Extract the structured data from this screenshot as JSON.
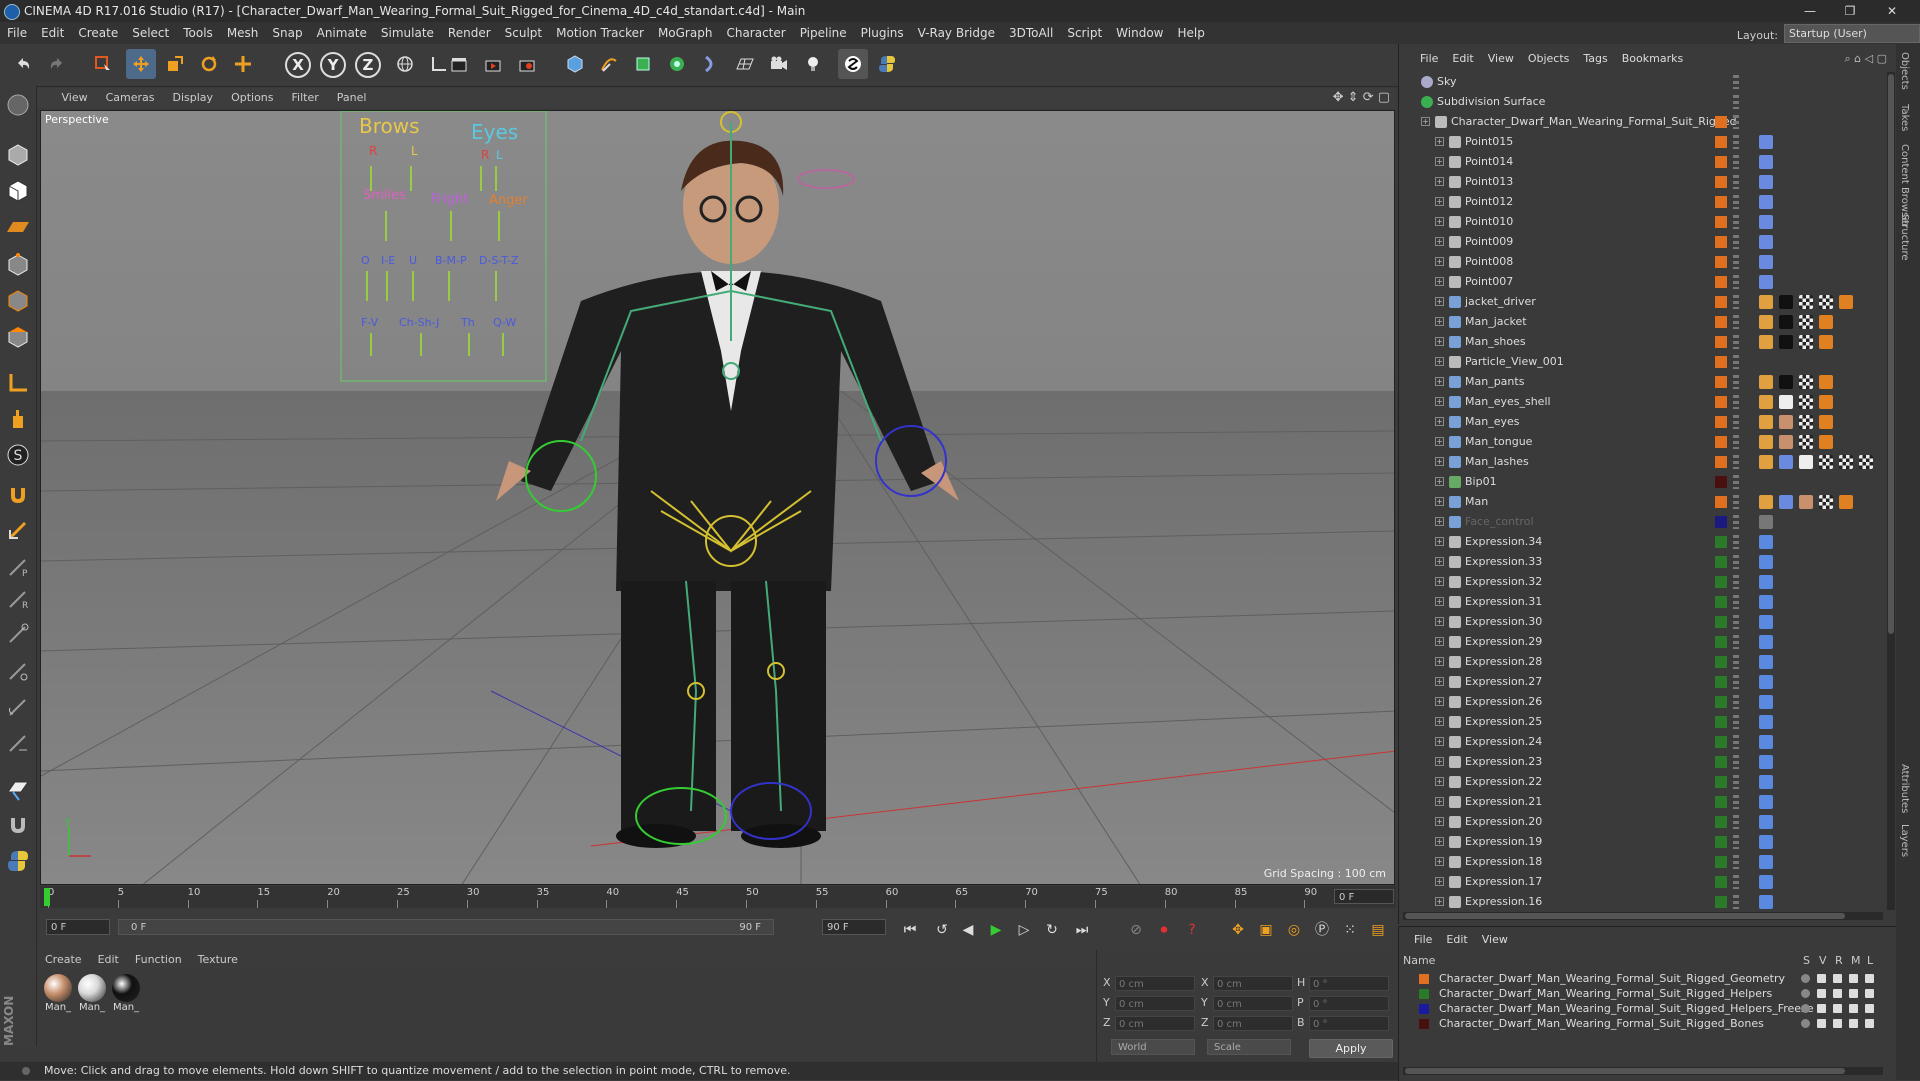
{
  "window": {
    "title": "CINEMA 4D R17.016 Studio (R17) - [Character_Dwarf_Man_Wearing_Formal_Suit_Rigged_for_Cinema_4D_c4d_standart.c4d] - Main",
    "controls": [
      "—",
      "❐",
      "✕"
    ]
  },
  "menubar": {
    "items": [
      "File",
      "Edit",
      "Create",
      "Select",
      "Tools",
      "Mesh",
      "Snap",
      "Animate",
      "Simulate",
      "Render",
      "Sculpt",
      "Motion Tracker",
      "MoGraph",
      "Character",
      "Pipeline",
      "Plugins",
      "V-Ray Bridge",
      "3DToAll",
      "Script",
      "Window",
      "Help"
    ],
    "layout_label": "Layout:",
    "layout_value": "Startup (User)"
  },
  "toolbar": {
    "axis": [
      "X",
      "Y",
      "Z"
    ]
  },
  "viewport": {
    "menu": [
      "View",
      "Cameras",
      "Display",
      "Options",
      "Filter",
      "Panel"
    ],
    "label": "Perspective",
    "grid_spacing": "Grid Spacing : 100 cm",
    "face_controls": {
      "brows": "Brows",
      "eyes": "Eyes",
      "r1": "R",
      "l1": "L",
      "r2": "R",
      "l2": "L",
      "smiles": "Smiles",
      "fright": "Fright",
      "anger": "Anger",
      "row1": [
        "O",
        "I-E",
        "U",
        "B-M-P",
        "D-S-T-Z"
      ],
      "row2": [
        "F-V",
        "Ch-Sh-J",
        "Th",
        "Q-W"
      ]
    }
  },
  "timeline": {
    "ticks": [
      "0",
      "5",
      "10",
      "15",
      "20",
      "25",
      "30",
      "35",
      "40",
      "45",
      "50",
      "55",
      "60",
      "65",
      "70",
      "75",
      "80",
      "85",
      "90"
    ],
    "frame": "0 F",
    "start": "0 F",
    "range_start": "0 F",
    "range_end": "90 F",
    "end": "90 F"
  },
  "material_manager": {
    "menu": [
      "Create",
      "Edit",
      "Function",
      "Texture"
    ],
    "materials": [
      {
        "name": "Man_",
        "color": "#c8906c"
      },
      {
        "name": "Man_",
        "color": "#d8d8d8"
      },
      {
        "name": "Man_",
        "color": "#111111"
      }
    ]
  },
  "coordinates": {
    "rows": [
      {
        "a": "X",
        "av": "0 cm",
        "b": "X",
        "bv": "0 cm",
        "c": "H",
        "cv": "0 °"
      },
      {
        "a": "Y",
        "av": "0 cm",
        "b": "Y",
        "bv": "0 cm",
        "c": "P",
        "cv": "0 °"
      },
      {
        "a": "Z",
        "av": "0 cm",
        "b": "Z",
        "bv": "0 cm",
        "c": "B",
        "cv": "0 °"
      }
    ],
    "space": "World",
    "mode": "Scale",
    "apply": "Apply"
  },
  "status": "Move: Click and drag to move elements. Hold down SHIFT to quantize movement / add to the selection in point mode, CTRL to remove.",
  "objects_panel": {
    "menu": [
      "File",
      "Edit",
      "View",
      "Objects",
      "Tags",
      "Bookmarks"
    ],
    "rows": [
      {
        "name": "Sky",
        "indent": 0,
        "icon": "sky",
        "layer": "none",
        "tags": []
      },
      {
        "name": "Subdivision Surface",
        "indent": 0,
        "icon": "subdiv",
        "layer": "none",
        "tags": []
      },
      {
        "name": "Character_Dwarf_Man_Wearing_Formal_Suit_Rigged",
        "indent": 1,
        "icon": "null",
        "layer": "#e07020",
        "tags": []
      },
      {
        "name": "Point015",
        "indent": 2,
        "icon": "null",
        "layer": "#e07020",
        "tags": [
          "pin"
        ]
      },
      {
        "name": "Point014",
        "indent": 2,
        "icon": "null",
        "layer": "#e07020",
        "tags": [
          "pin"
        ]
      },
      {
        "name": "Point013",
        "indent": 2,
        "icon": "null",
        "layer": "#e07020",
        "tags": [
          "pin"
        ]
      },
      {
        "name": "Point012",
        "indent": 2,
        "icon": "null",
        "layer": "#e07020",
        "tags": [
          "pin"
        ]
      },
      {
        "name": "Point010",
        "indent": 2,
        "icon": "null",
        "layer": "#e07020",
        "tags": [
          "pin"
        ]
      },
      {
        "name": "Point009",
        "indent": 2,
        "icon": "null",
        "layer": "#e07020",
        "tags": [
          "pin"
        ]
      },
      {
        "name": "Point008",
        "indent": 2,
        "icon": "null",
        "layer": "#e07020",
        "tags": [
          "pin"
        ]
      },
      {
        "name": "Point007",
        "indent": 2,
        "icon": "null",
        "layer": "#e07020",
        "tags": [
          "pin"
        ]
      },
      {
        "name": "jacket_driver",
        "indent": 2,
        "icon": "poly",
        "layer": "#e07020",
        "tags": [
          "mat",
          "black",
          "check",
          "check",
          "dot"
        ]
      },
      {
        "name": "Man_jacket",
        "indent": 2,
        "icon": "poly",
        "layer": "#e07020",
        "tags": [
          "mat",
          "black",
          "check",
          "dot"
        ]
      },
      {
        "name": "Man_shoes",
        "indent": 2,
        "icon": "poly",
        "layer": "#e07020",
        "tags": [
          "mat",
          "black",
          "check",
          "dot"
        ]
      },
      {
        "name": "Particle_View_001",
        "indent": 2,
        "icon": "null",
        "layer": "#e07020",
        "tags": []
      },
      {
        "name": "Man_pants",
        "indent": 2,
        "icon": "poly",
        "layer": "#e07020",
        "tags": [
          "mat",
          "black",
          "check",
          "dot"
        ]
      },
      {
        "name": "Man_eyes_shell",
        "indent": 2,
        "icon": "poly",
        "layer": "#e07020",
        "tags": [
          "mat",
          "white",
          "check",
          "dot"
        ]
      },
      {
        "name": "Man_eyes",
        "indent": 2,
        "icon": "poly",
        "layer": "#e07020",
        "tags": [
          "mat",
          "skin",
          "check",
          "dot"
        ]
      },
      {
        "name": "Man_tongue",
        "indent": 2,
        "icon": "poly",
        "layer": "#e07020",
        "tags": [
          "mat",
          "skin",
          "check",
          "dot"
        ]
      },
      {
        "name": "Man_lashes",
        "indent": 2,
        "icon": "poly",
        "layer": "#e07020",
        "tags": [
          "mat",
          "pin",
          "white",
          "check",
          "check",
          "check"
        ]
      },
      {
        "name": "Bip01",
        "indent": 2,
        "icon": "bone",
        "layer": "#4a1010",
        "tags": []
      },
      {
        "name": "Man",
        "indent": 2,
        "icon": "poly",
        "layer": "#e07020",
        "tags": [
          "mat",
          "pin",
          "skin",
          "check",
          "dot"
        ]
      },
      {
        "name": "Face_control",
        "indent": 2,
        "icon": "poly",
        "layer": "#1a1a80",
        "tags": [
          "grey"
        ],
        "dim": true
      },
      {
        "name": "Expression.34",
        "indent": 2,
        "icon": "null",
        "layer": "#2a7a2a",
        "tags": [
          "exp"
        ]
      },
      {
        "name": "Expression.33",
        "indent": 2,
        "icon": "null",
        "layer": "#2a7a2a",
        "tags": [
          "exp"
        ]
      },
      {
        "name": "Expression.32",
        "indent": 2,
        "icon": "null",
        "layer": "#2a7a2a",
        "tags": [
          "exp"
        ]
      },
      {
        "name": "Expression.31",
        "indent": 2,
        "icon": "null",
        "layer": "#2a7a2a",
        "tags": [
          "exp"
        ]
      },
      {
        "name": "Expression.30",
        "indent": 2,
        "icon": "null",
        "layer": "#2a7a2a",
        "tags": [
          "exp"
        ]
      },
      {
        "name": "Expression.29",
        "indent": 2,
        "icon": "null",
        "layer": "#2a7a2a",
        "tags": [
          "exp"
        ]
      },
      {
        "name": "Expression.28",
        "indent": 2,
        "icon": "null",
        "layer": "#2a7a2a",
        "tags": [
          "exp"
        ]
      },
      {
        "name": "Expression.27",
        "indent": 2,
        "icon": "null",
        "layer": "#2a7a2a",
        "tags": [
          "exp"
        ]
      },
      {
        "name": "Expression.26",
        "indent": 2,
        "icon": "null",
        "layer": "#2a7a2a",
        "tags": [
          "exp"
        ]
      },
      {
        "name": "Expression.25",
        "indent": 2,
        "icon": "null",
        "layer": "#2a7a2a",
        "tags": [
          "exp"
        ]
      },
      {
        "name": "Expression.24",
        "indent": 2,
        "icon": "null",
        "layer": "#2a7a2a",
        "tags": [
          "exp"
        ]
      },
      {
        "name": "Expression.23",
        "indent": 2,
        "icon": "null",
        "layer": "#2a7a2a",
        "tags": [
          "exp"
        ]
      },
      {
        "name": "Expression.22",
        "indent": 2,
        "icon": "null",
        "layer": "#2a7a2a",
        "tags": [
          "exp"
        ]
      },
      {
        "name": "Expression.21",
        "indent": 2,
        "icon": "null",
        "layer": "#2a7a2a",
        "tags": [
          "exp"
        ]
      },
      {
        "name": "Expression.20",
        "indent": 2,
        "icon": "null",
        "layer": "#2a7a2a",
        "tags": [
          "exp"
        ]
      },
      {
        "name": "Expression.19",
        "indent": 2,
        "icon": "null",
        "layer": "#2a7a2a",
        "tags": [
          "exp"
        ]
      },
      {
        "name": "Expression.18",
        "indent": 2,
        "icon": "null",
        "layer": "#2a7a2a",
        "tags": [
          "exp"
        ]
      },
      {
        "name": "Expression.17",
        "indent": 2,
        "icon": "null",
        "layer": "#2a7a2a",
        "tags": [
          "exp"
        ]
      },
      {
        "name": "Expression.16",
        "indent": 2,
        "icon": "null",
        "layer": "#2a7a2a",
        "tags": [
          "exp"
        ]
      }
    ]
  },
  "layers_panel": {
    "menu": [
      "File",
      "Edit",
      "View"
    ],
    "header": {
      "name": "Name",
      "cols": [
        "S",
        "V",
        "R",
        "M",
        "L"
      ]
    },
    "layers": [
      {
        "name": "Character_Dwarf_Man_Wearing_Formal_Suit_Rigged_Geometry",
        "color": "#e07020"
      },
      {
        "name": "Character_Dwarf_Man_Wearing_Formal_Suit_Rigged_Helpers",
        "color": "#2a7a2a"
      },
      {
        "name": "Character_Dwarf_Man_Wearing_Formal_Suit_Rigged_Helpers_Freeze",
        "color": "#1a1aa0"
      },
      {
        "name": "Character_Dwarf_Man_Wearing_Formal_Suit_Rigged_Bones",
        "color": "#4a1010"
      }
    ]
  },
  "side_tabs": [
    "Objects",
    "Takes",
    "Content Browser",
    "Structure",
    "Attributes",
    "Layers"
  ]
}
